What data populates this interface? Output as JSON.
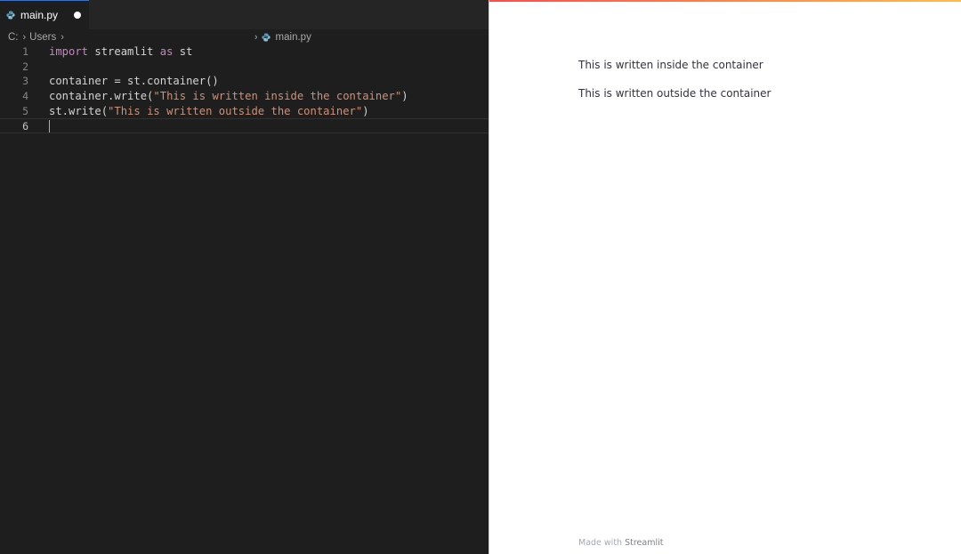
{
  "editor": {
    "tab": {
      "filename": "main.py",
      "icon": "python-file-icon",
      "modified": true
    },
    "breadcrumbs": {
      "drive": "C:",
      "folder": "Users",
      "file": "main.py"
    },
    "lines": [
      {
        "number": "1",
        "tokens": [
          {
            "t": "import",
            "k": "kw"
          },
          {
            "t": " streamlit ",
            "k": ""
          },
          {
            "t": "as",
            "k": "kw"
          },
          {
            "t": " st",
            "k": ""
          }
        ]
      },
      {
        "number": "2",
        "tokens": []
      },
      {
        "number": "3",
        "tokens": [
          {
            "t": "container = st.container()",
            "k": ""
          }
        ]
      },
      {
        "number": "4",
        "tokens": [
          {
            "t": "container.write(",
            "k": ""
          },
          {
            "t": "\"This is written inside the container\"",
            "k": "str"
          },
          {
            "t": ")",
            "k": ""
          }
        ]
      },
      {
        "number": "5",
        "tokens": [
          {
            "t": "st.write(",
            "k": ""
          },
          {
            "t": "\"This is written outside the container\"",
            "k": "str"
          },
          {
            "t": ")",
            "k": ""
          }
        ]
      },
      {
        "number": "6",
        "tokens": [],
        "active": true
      }
    ]
  },
  "preview": {
    "inside_text": "This is written inside the container",
    "outside_text": "This is written outside the container",
    "footer_prefix": "Made with ",
    "footer_link": "Streamlit"
  },
  "colors": {
    "keyword": "#c586c0",
    "string": "#ce9178",
    "editor_bg": "#1e1e1e",
    "preview_bg": "#ffffff",
    "streamlit_accent": "#ff4b4b"
  }
}
